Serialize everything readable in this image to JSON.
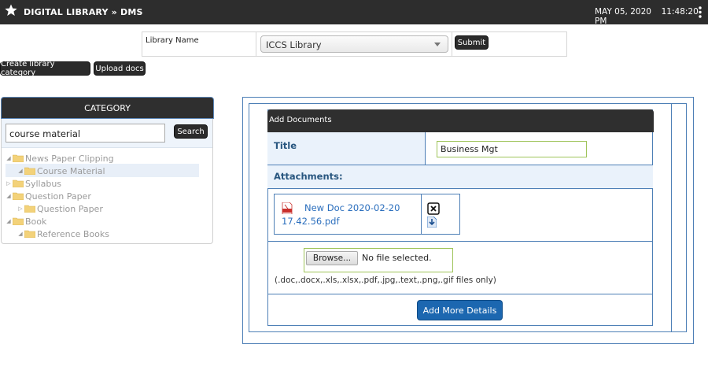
{
  "topbar": {
    "title": "DIGITAL LIBRARY » DMS",
    "date": "MAY 05, 2020",
    "time": "11:48:20 PM"
  },
  "library": {
    "label": "Library Name",
    "selected": "ICCS Library",
    "submit_label": "Submit"
  },
  "actions": {
    "create_category": "Create library category",
    "upload_docs": "Upload docs"
  },
  "category": {
    "header": "CATEGORY",
    "search_value": "course material",
    "search_button": "Search",
    "tree": [
      {
        "label": "News Paper Clipping",
        "children": [
          {
            "label": "Course Material",
            "selected": true
          }
        ]
      },
      {
        "label": "Syllabus",
        "children": []
      },
      {
        "label": "Question Paper",
        "children": [
          {
            "label": "Question Paper"
          }
        ]
      },
      {
        "label": "Book",
        "children": [
          {
            "label": "Reference Books"
          }
        ]
      }
    ]
  },
  "form": {
    "header": "Add Documents",
    "title_label": "Title",
    "title_value": "Business Mgt",
    "attachments_label": "Attachments:",
    "attachment": {
      "name_line1": "New Doc 2020-02-20",
      "name_line2": "17.42.56.pdf"
    },
    "browse_label": "Browse...",
    "no_file": "No file selected.",
    "hint": "(.doc,.docx,.xls,.xlsx,.pdf,.jpg,.text,.png,.gif files only)",
    "add_more": "Add More Details"
  },
  "colors": {
    "accent_blue": "#1c67b0",
    "border_blue": "#4d7fb6",
    "dark_bar": "#2d2d2d"
  }
}
